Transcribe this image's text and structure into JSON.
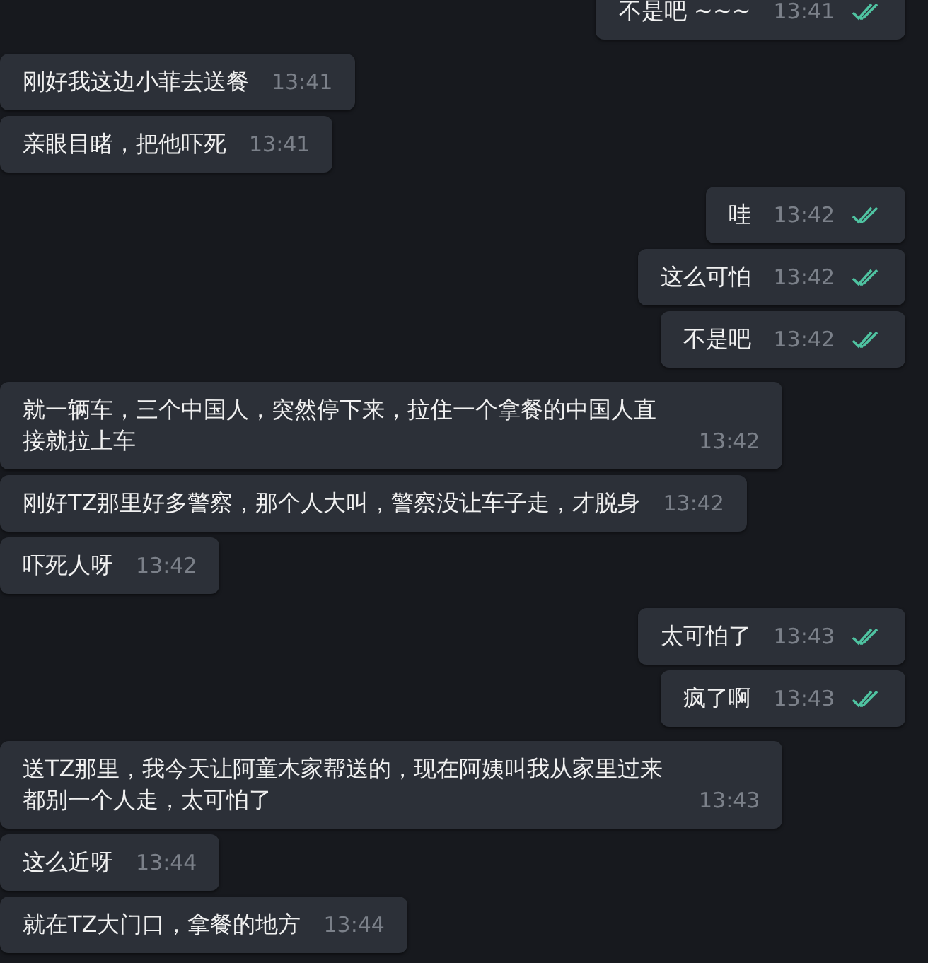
{
  "groups": [
    {
      "kind": "outgoing",
      "messages": [
        {
          "text": "不是吧 ~~~",
          "time": "13:41",
          "read": true
        }
      ]
    },
    {
      "kind": "incoming",
      "messages": [
        {
          "text": "刚好我这边小菲去送餐",
          "time": "13:41"
        },
        {
          "text": "亲眼目睹，把他吓死",
          "time": "13:41"
        }
      ]
    },
    {
      "kind": "outgoing",
      "messages": [
        {
          "text": "哇",
          "time": "13:42",
          "read": true
        },
        {
          "text": "这么可怕",
          "time": "13:42",
          "read": true
        },
        {
          "text": "不是吧",
          "time": "13:42",
          "read": true
        }
      ]
    },
    {
      "kind": "incoming",
      "messages": [
        {
          "text": "就一辆车，三个中国人，突然停下来，拉住一个拿餐的中国人直接就拉上车",
          "time": "13:42"
        },
        {
          "text": "刚好TZ那里好多警察，那个人大叫，警察没让车子走，才脱身",
          "time": "13:42"
        },
        {
          "text": "吓死人呀",
          "time": "13:42"
        }
      ]
    },
    {
      "kind": "outgoing",
      "messages": [
        {
          "text": "太可怕了",
          "time": "13:43",
          "read": true
        },
        {
          "text": "疯了啊",
          "time": "13:43",
          "read": true
        }
      ]
    },
    {
      "kind": "incoming",
      "messages": [
        {
          "text": "送TZ那里，我今天让阿童木家帮送的，现在阿姨叫我从家里过来都别一个人走，太可怕了",
          "time": "13:43"
        },
        {
          "text": "这么近呀",
          "time": "13:44"
        },
        {
          "text": "就在TZ大门口，拿餐的地方",
          "time": "13:44"
        }
      ]
    }
  ]
}
